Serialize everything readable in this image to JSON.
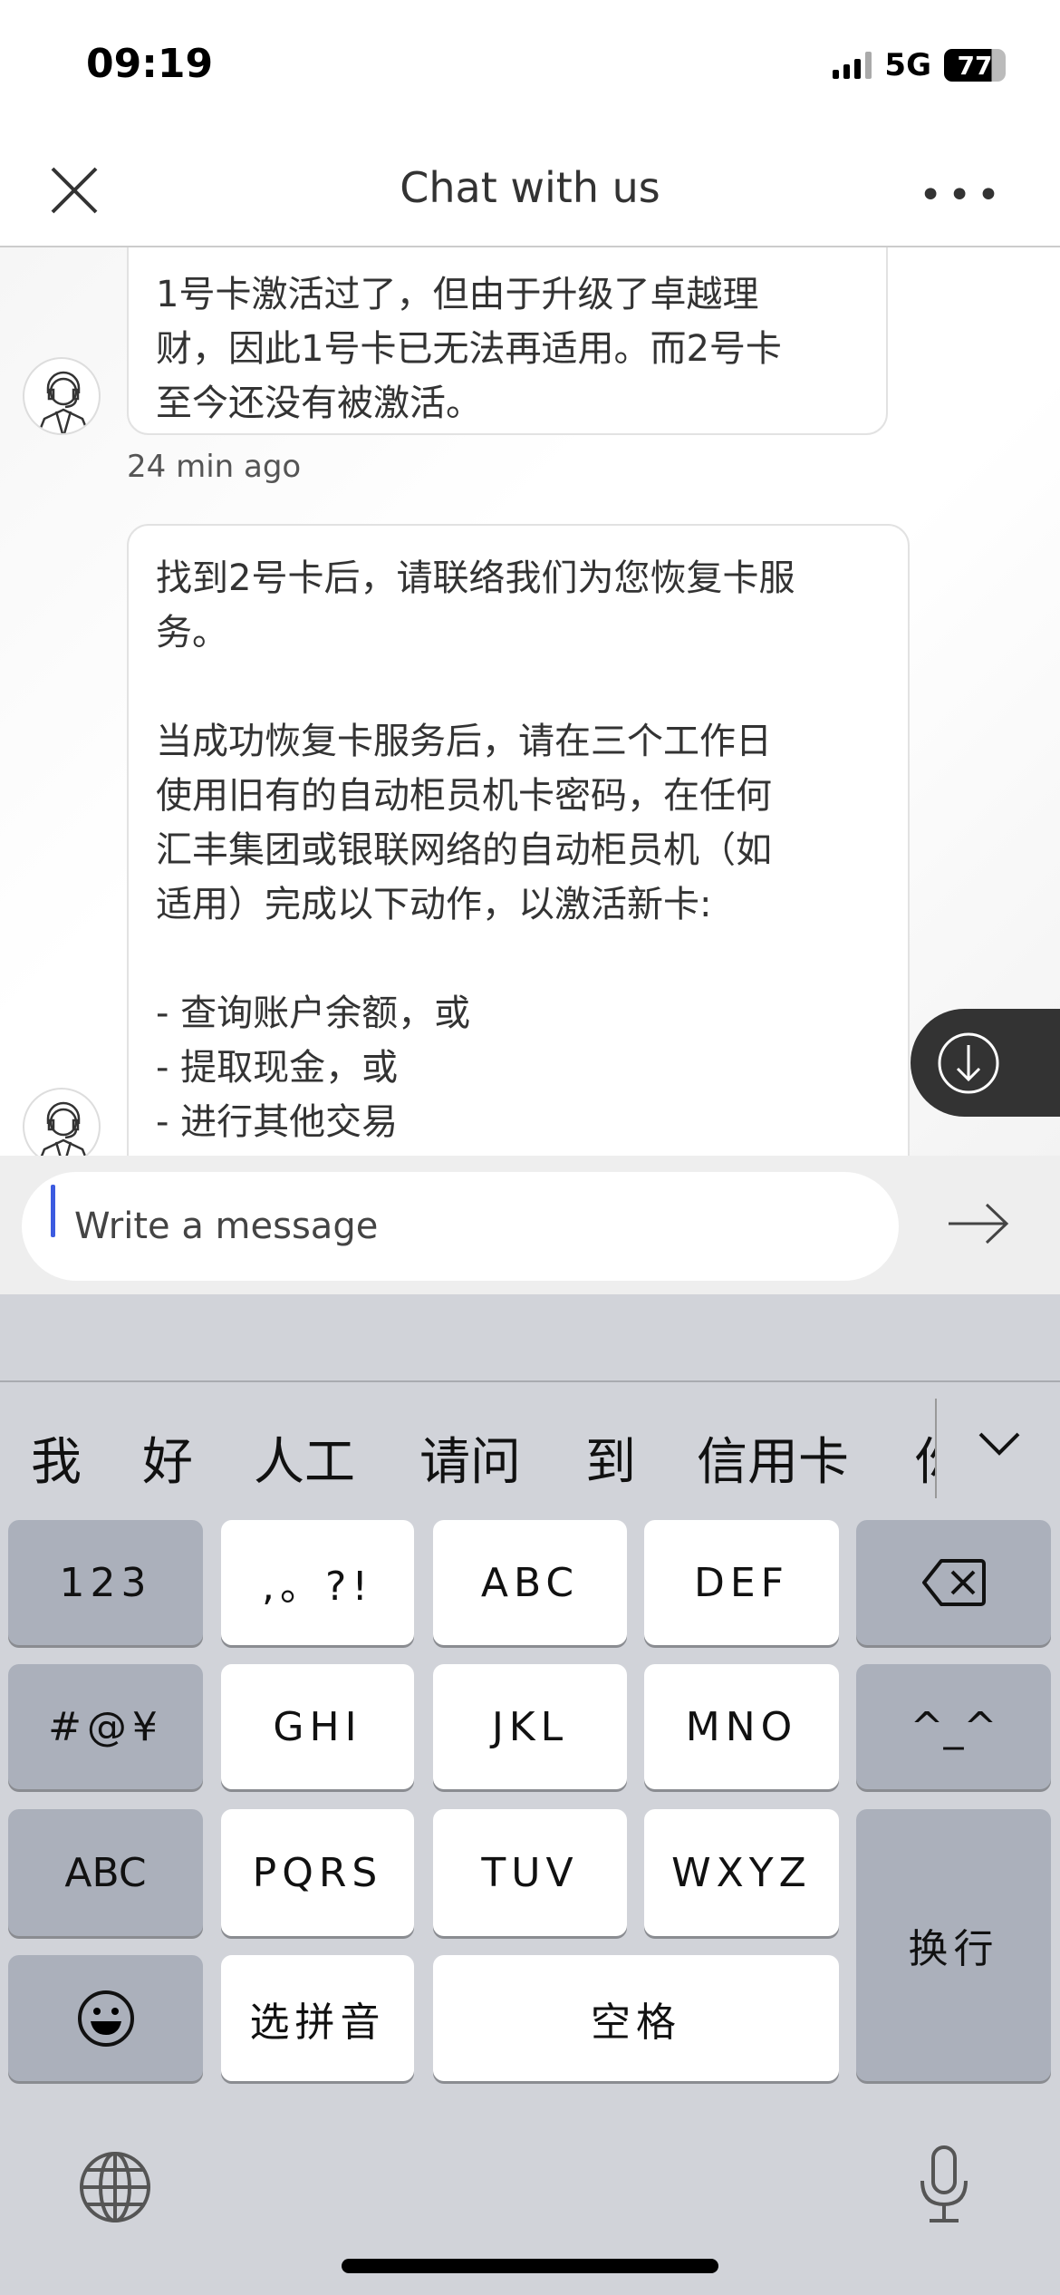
{
  "status": {
    "time": "09:19",
    "network": "5G",
    "battery": "77"
  },
  "header": {
    "title": "Chat with us",
    "close_icon": "close-icon",
    "more_icon": "more-icon"
  },
  "messages": [
    {
      "text": "1号卡激活过了，但由于升级了卓越理\n财，因此1号卡已无法再适用。而2号卡\n至今还没有被激活。",
      "time": "24 min ago"
    },
    {
      "text": "找到2号卡后，请联络我们为您恢复卡服\n务。\n\n当成功恢复卡服务后，请在三个工作日\n使用旧有的自动柜员机卡密码，在任何\n汇丰集团或银联网络的自动柜员机（如\n适用）完成以下动作，以激活新卡:\n\n- 查询账户余额，或\n- 提取现金，或\n- 进行其他交易"
    }
  ],
  "composer": {
    "placeholder": "Write a message",
    "accent": "#3c5be0"
  },
  "keyboard": {
    "candidates": [
      "我",
      "好",
      "人工",
      "请问",
      "到",
      "信用卡",
      "你"
    ],
    "keys": {
      "num": "123",
      "punct": ",。?!",
      "abc": "ABC",
      "def": "DEF",
      "sym": "#@¥",
      "ghi": "GHI",
      "jkl": "JKL",
      "mno": "MNO",
      "emoticon": "^_^",
      "abc_mode": "ABC",
      "pqrs": "PQRS",
      "tuv": "TUV",
      "wxyz": "WXYZ",
      "enter": "换行",
      "pinyin": "选拼音",
      "space": "空格"
    }
  }
}
